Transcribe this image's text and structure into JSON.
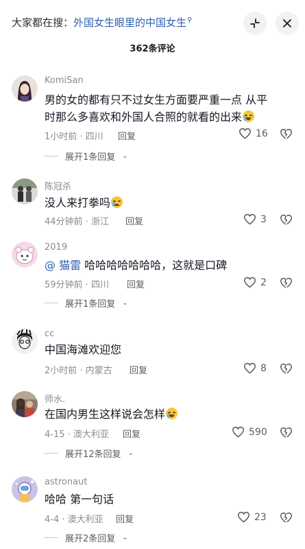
{
  "header": {
    "search_prefix": "大家都在搜：",
    "search_query": "外国女生眼里的中国女生",
    "search_icon": "search-icon",
    "comment_count_title": "362条评论"
  },
  "comments": [
    {
      "username": "KomiSan",
      "text": "男的女的都有只不过女生方面要严重一点 从平时那么多喜欢和外国人合照的就看的出来",
      "emoji": "crying-laughing-emoji",
      "meta": "1小时前 · 四川",
      "reply": "回复",
      "likes": "16",
      "expand": "展开1条回复"
    },
    {
      "username": "陈冠杀",
      "text": "没人来打拳吗",
      "emoji": "crying-emoji",
      "meta": "44分钟前 · 浙江",
      "reply": "回复",
      "likes": "3"
    },
    {
      "username": "2019",
      "mention": "@ 猫雷",
      "text": " 哈哈哈哈哈哈哈，这就是口碑",
      "meta": "59分钟前 · 四川",
      "reply": "回复",
      "likes": "2",
      "expand": "展开1条回复"
    },
    {
      "username": "cc",
      "text": "中国海滩欢迎您",
      "meta": "2小时前 · 内蒙古",
      "reply": "回复",
      "likes": "8"
    },
    {
      "username": "师水.",
      "text": "在国内男生这样说会怎样",
      "emoji": "crying-laughing-emoji",
      "meta": "4-15 · 澳大利亚",
      "reply": "回复",
      "likes": "590",
      "expand": "展开12条回复"
    },
    {
      "username": "astronaut",
      "text": "哈哈 第一句话",
      "meta": "4-4 · 澳大利亚",
      "reply": "回复",
      "likes": "23",
      "expand": "展开2条回复"
    }
  ],
  "icons": {
    "collapse": "collapse-icon",
    "close": "close-icon",
    "like": "heart-icon",
    "dislike": "broken-heart-icon",
    "expand": "chevron-down-icon"
  },
  "colors": {
    "link": "#2f5fb3",
    "muted": "#8a8b91",
    "text": "#161823"
  }
}
